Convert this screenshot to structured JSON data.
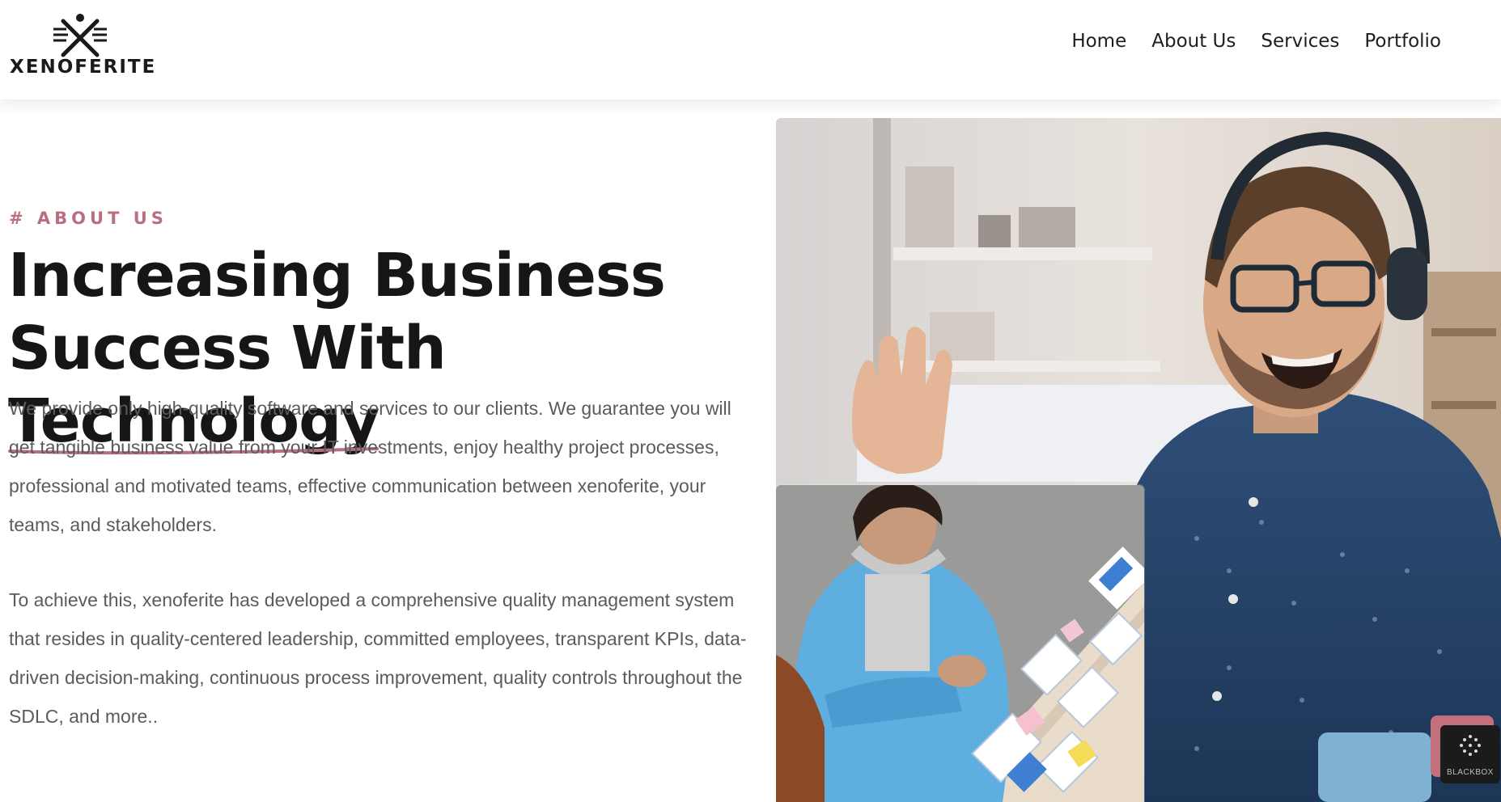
{
  "brand": {
    "name": "XENOFERITE"
  },
  "nav": {
    "items": [
      {
        "label": "Home"
      },
      {
        "label": "About Us"
      },
      {
        "label": "Services"
      },
      {
        "label": "Portfolio"
      }
    ]
  },
  "hero": {
    "eyebrow": "# ABOUT US",
    "headline_line1": "Increasing Business",
    "headline_line2_prefix": "Success With ",
    "headline_highlight": "Technology",
    "paragraph1": "We provide only high-quality software and services to our clients. We guarantee you will get tangible business value from your IT investments, enjoy healthy project processes, professional and motivated teams, effective communication between xenoferite, your teams, and stakeholders.",
    "paragraph2": "To achieve this, xenoferite has developed a comprehensive quality management system that resides in quality-centered leadership, committed employees, transparent KPIs, data-driven decision-making, continuous process improvement, quality controls throughout the SDLC, and more.."
  },
  "widget": {
    "label": "BLACKBOX",
    "icon": "blackbox-logo-icon"
  },
  "colors": {
    "accent": "#b8707f",
    "text": "#161616",
    "body_text": "#5b5b5b"
  }
}
